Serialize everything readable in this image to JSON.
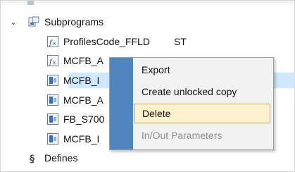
{
  "tree": {
    "group": {
      "label": "Subprograms",
      "expanded": true
    },
    "items": [
      {
        "label": "ProfilesCode_FFLD",
        "extra": "ST",
        "icon": "st-program-icon"
      },
      {
        "label": "MCFB_A",
        "icon": "st-program-icon"
      },
      {
        "label": "MCFB_I",
        "icon": "function-block-icon"
      },
      {
        "label": "MCFB_A",
        "icon": "function-block-icon"
      },
      {
        "label": "FB_S700",
        "icon": "function-block-icon"
      },
      {
        "label": "MCFB_I",
        "icon": "function-block-icon"
      }
    ],
    "defines": {
      "label": "Defines",
      "icon": "defines-icon"
    }
  },
  "context_menu": {
    "items": [
      {
        "label": "Export",
        "state": "normal"
      },
      {
        "label": "Create unlocked copy",
        "state": "normal"
      },
      {
        "label": "Delete",
        "state": "highlighted"
      },
      {
        "label": "In/Out Parameters",
        "state": "disabled"
      }
    ]
  },
  "colors": {
    "menu_gutter": "#4e86bd",
    "menu_background": "#f2f2f2",
    "highlight_fill": "#fff2cc",
    "highlight_border": "#c8a93e",
    "selection": "#cde8ff",
    "disabled_text": "#8f8f8f"
  }
}
